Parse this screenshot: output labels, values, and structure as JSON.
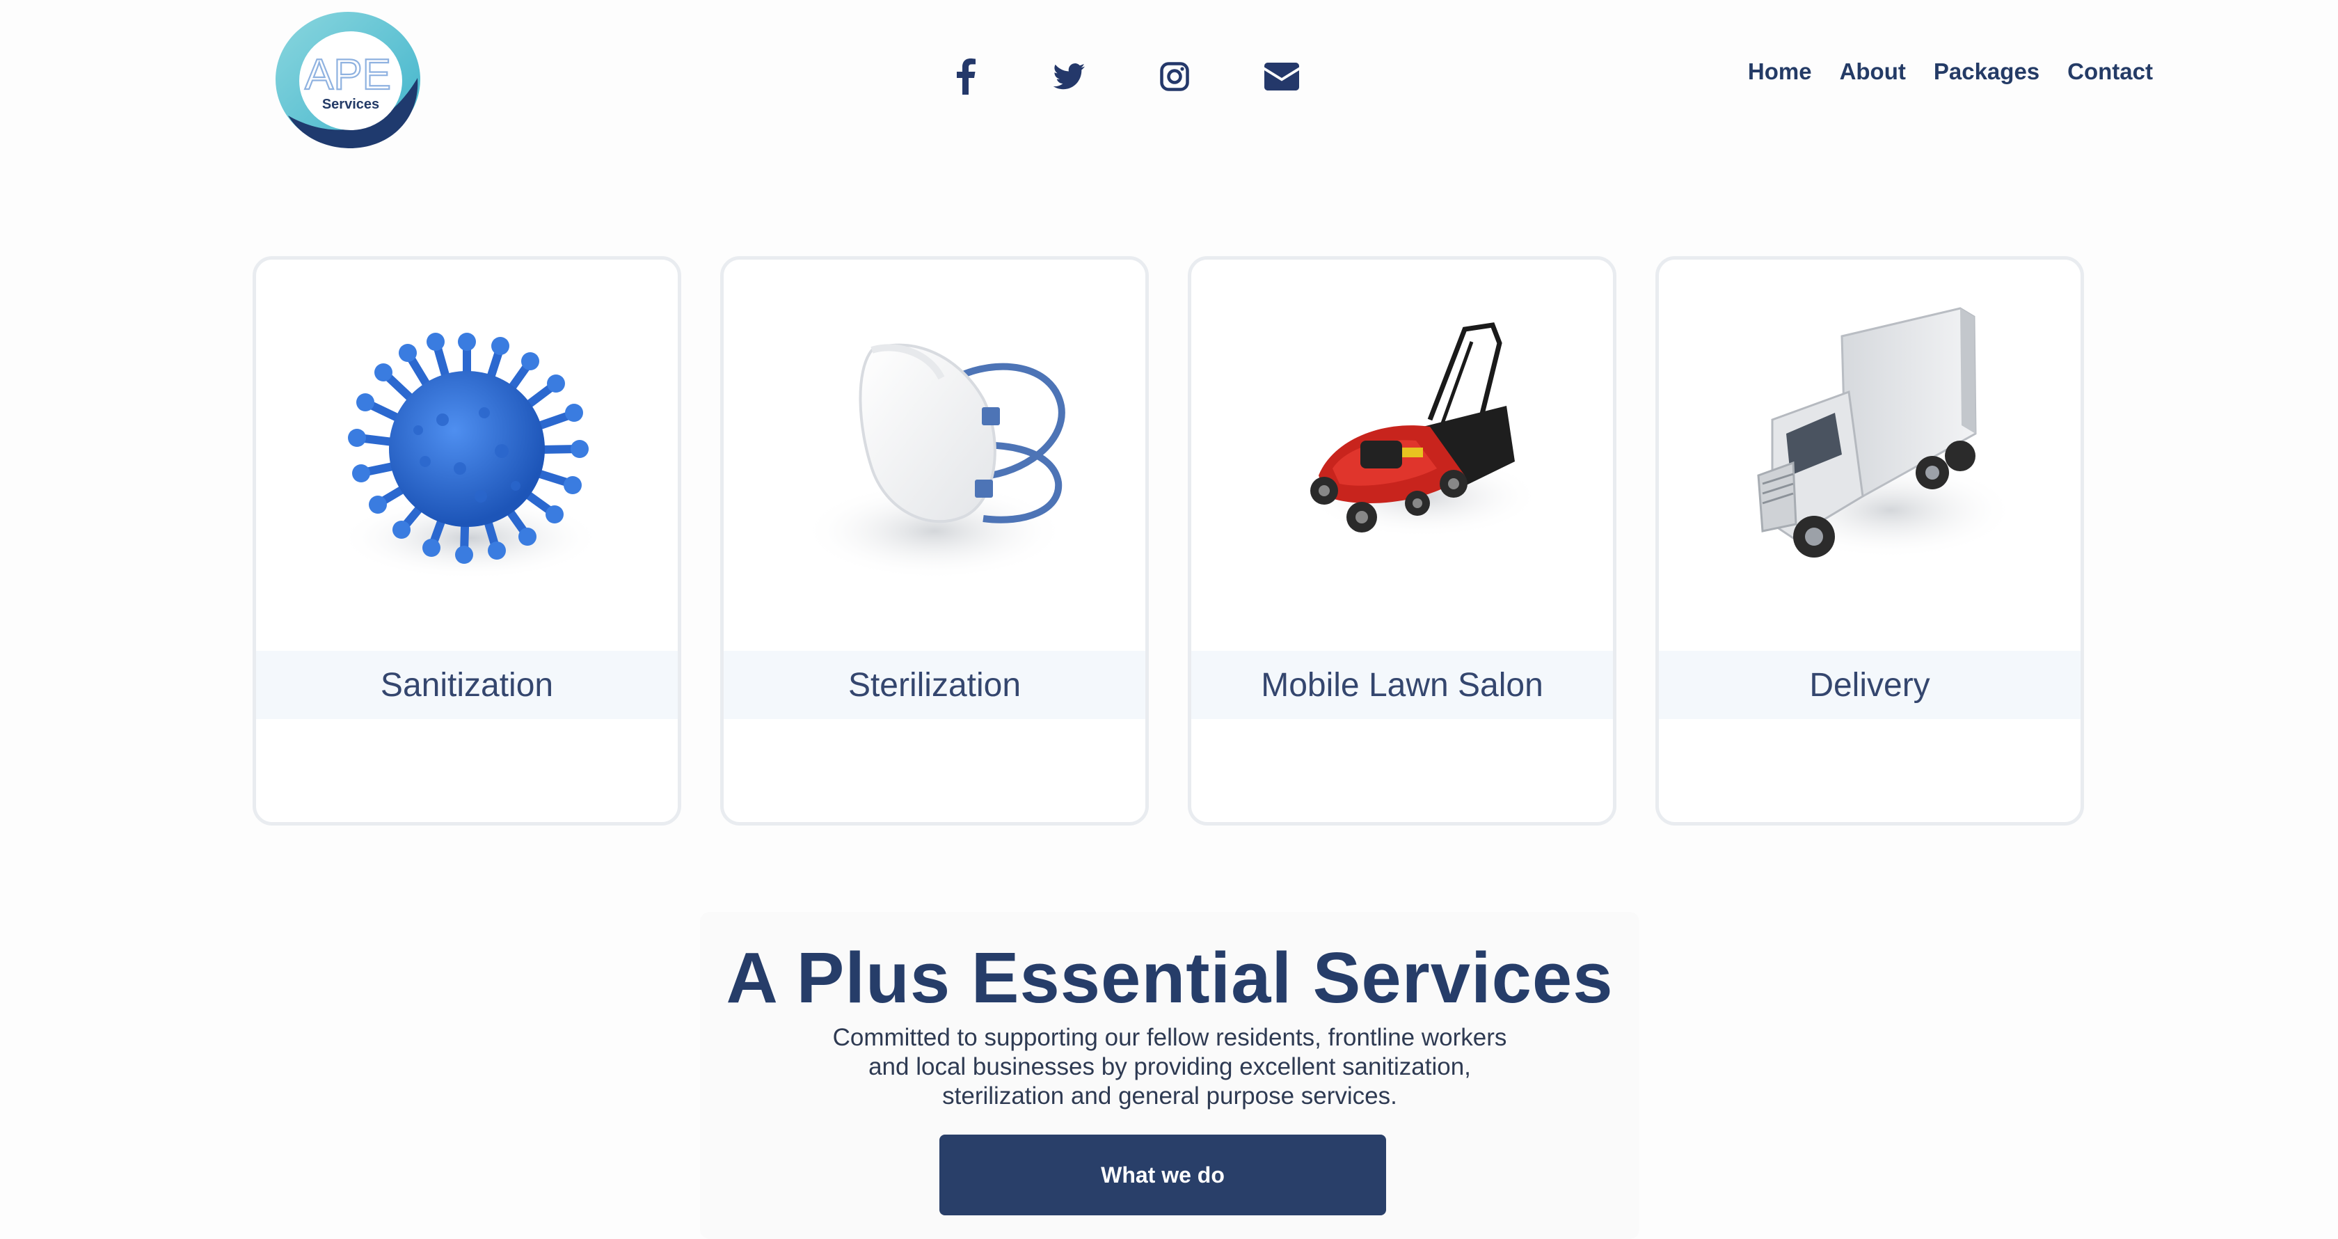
{
  "header": {
    "logo": {
      "text_main": "APE",
      "text_sub": "Services",
      "icon": "ape-services-logo"
    },
    "social": [
      {
        "name": "facebook",
        "icon": "facebook-icon"
      },
      {
        "name": "twitter",
        "icon": "twitter-icon"
      },
      {
        "name": "instagram",
        "icon": "instagram-icon"
      },
      {
        "name": "email",
        "icon": "envelope-icon"
      }
    ],
    "nav": [
      {
        "label": "Home"
      },
      {
        "label": "About"
      },
      {
        "label": "Packages"
      },
      {
        "label": "Contact"
      }
    ]
  },
  "services": [
    {
      "label": "Sanitization",
      "icon": "virus-icon"
    },
    {
      "label": "Sterilization",
      "icon": "face-mask-icon"
    },
    {
      "label": "Mobile Lawn Salon",
      "icon": "lawn-mower-icon"
    },
    {
      "label": "Delivery",
      "icon": "delivery-truck-icon"
    }
  ],
  "hero": {
    "title": "A Plus Essential Services",
    "line1": "Committed to supporting our fellow residents, frontline workers",
    "line2": "and local businesses by providing excellent sanitization,",
    "line3": "sterilization and general purpose services.",
    "cta_label": "What we do"
  },
  "colors": {
    "brand_navy": "#263d69",
    "label_text": "#34466e",
    "card_border": "#e9ecf0",
    "label_band": "#f4f8fc",
    "logo_teal": "#57c1d3",
    "virus_blue": "#2f6fd6",
    "mower_red": "#c8241d"
  }
}
